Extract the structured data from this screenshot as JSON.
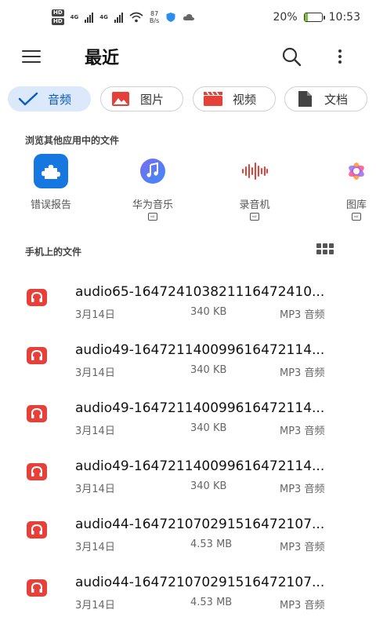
{
  "status_bar": {
    "sim1": "HD",
    "sim2": "HD",
    "net1": "4G",
    "net2": "4G",
    "speed_value": "87",
    "speed_unit": "B/s",
    "battery": "20%",
    "battery_level": 0.2,
    "time": "10:53"
  },
  "app_bar": {
    "title": "最近",
    "menu_icon": "hamburger-icon",
    "search_icon": "search-icon",
    "more_icon": "more-vertical-icon"
  },
  "filters": [
    {
      "label": "音频",
      "icon": "check-icon",
      "active": true
    },
    {
      "label": "图片",
      "icon": "image-icon",
      "active": false
    },
    {
      "label": "视频",
      "icon": "video-icon",
      "active": false
    },
    {
      "label": "文档",
      "icon": "document-icon",
      "active": false
    }
  ],
  "other_apps": {
    "title": "浏览其他应用中的文件",
    "items": [
      {
        "label": "错误报告",
        "icon": "puzzle-icon"
      },
      {
        "label": "华为音乐",
        "icon": "music-note-icon"
      },
      {
        "label": "录音机",
        "icon": "waveform-icon"
      },
      {
        "label": "图库",
        "icon": "flower-icon"
      }
    ]
  },
  "phone_files": {
    "title": "手机上的文件",
    "view_icon": "grid-view-icon",
    "files": [
      {
        "name": "audio65-164724103821116472410...",
        "date": "3月14日",
        "size": "340 KB",
        "type": "MP3 音频"
      },
      {
        "name": "audio49-164721140099616472114...",
        "date": "3月14日",
        "size": "340 KB",
        "type": "MP3 音频"
      },
      {
        "name": "audio49-164721140099616472114...",
        "date": "3月14日",
        "size": "340 KB",
        "type": "MP3 音频"
      },
      {
        "name": "audio49-164721140099616472114...",
        "date": "3月14日",
        "size": "340 KB",
        "type": "MP3 音频"
      },
      {
        "name": "audio44-164721070291516472107...",
        "date": "3月14日",
        "size": "4.53 MB",
        "type": "MP3 音频"
      },
      {
        "name": "audio44-164721070291516472107...",
        "date": "3月14日",
        "size": "4.53 MB",
        "type": "MP3 音频"
      }
    ]
  },
  "colors": {
    "accent": "#0a59c8",
    "active_chip_bg": "#dbe9fb",
    "audio_icon": "#e5403a"
  }
}
